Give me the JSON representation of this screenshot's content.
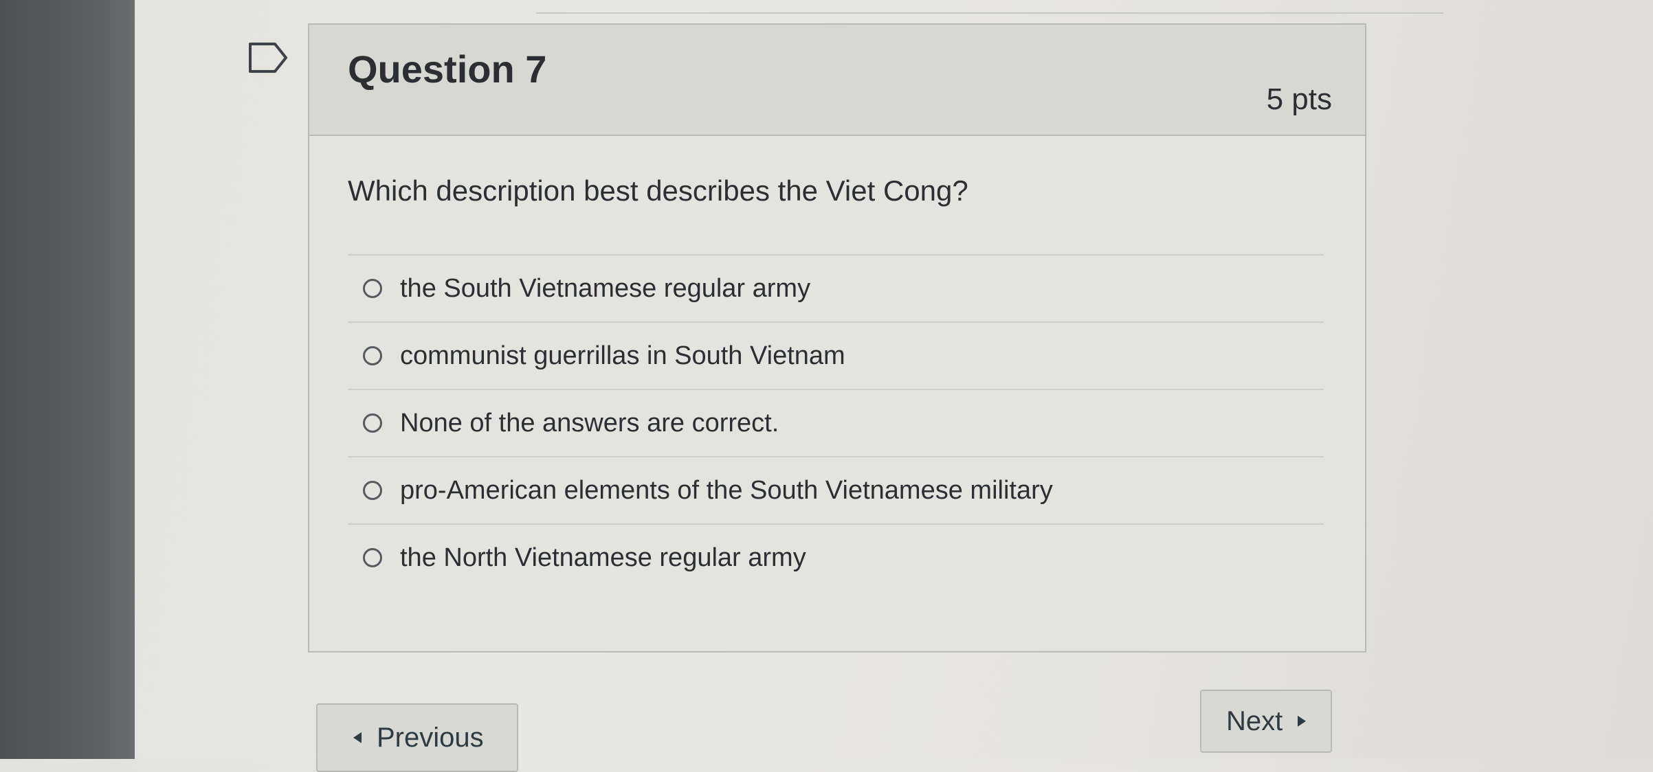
{
  "question": {
    "title": "Question 7",
    "points": "5 pts",
    "text": "Which description best describes the Viet Cong?",
    "answers": [
      {
        "label": "the South Vietnamese regular army"
      },
      {
        "label": "communist guerrillas in South Vietnam"
      },
      {
        "label": "None of the answers are correct."
      },
      {
        "label": "pro-American elements of the South Vietnamese military"
      },
      {
        "label": "the North Vietnamese regular army"
      }
    ]
  },
  "navigation": {
    "previous_label": "Previous",
    "next_label": "Next"
  },
  "icons": {
    "flag": "flag-icon",
    "previous": "triangle-left-icon",
    "next": "triangle-right-icon"
  }
}
